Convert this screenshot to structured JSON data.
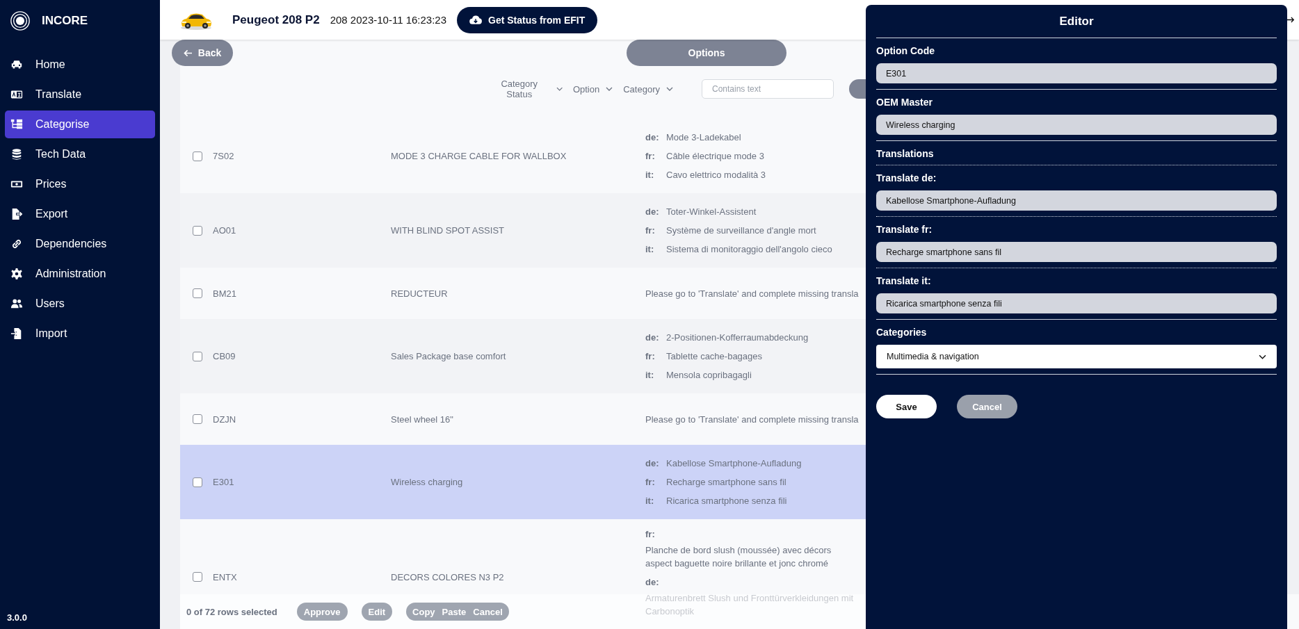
{
  "app": {
    "name": "INCORE",
    "version": "3.0.0"
  },
  "sidebar": {
    "items": [
      {
        "label": "Home",
        "selected": false
      },
      {
        "label": "Translate",
        "selected": false
      },
      {
        "label": "Categorise",
        "selected": true
      },
      {
        "label": "Tech Data",
        "selected": false
      },
      {
        "label": "Prices",
        "selected": false
      },
      {
        "label": "Export",
        "selected": false
      },
      {
        "label": "Dependencies",
        "selected": false
      },
      {
        "label": "Administration",
        "selected": false
      },
      {
        "label": "Users",
        "selected": false
      },
      {
        "label": "Import",
        "selected": false
      }
    ]
  },
  "header": {
    "vehicle": "Peugeot 208 P2",
    "snapshot": "208 2023-10-11 16:23:23",
    "status_button": "Get Status from EFIT"
  },
  "toolbar": {
    "back_button": "Back",
    "options_button": "Options"
  },
  "filters": [
    {
      "label": "Category Status"
    },
    {
      "label": "Option"
    },
    {
      "label": "Category"
    }
  ],
  "search": {
    "placeholder": "Contains text"
  },
  "table": {
    "rows": [
      {
        "kind": "inline",
        "checked": false,
        "selected": false,
        "code": "7S02",
        "description": "MODE 3 CHARGE CABLE FOR WALLBOX",
        "translations": [
          {
            "lang": "de:",
            "text": "Mode 3-Ladekabel"
          },
          {
            "lang": "fr:",
            "text": "Câble électrique mode 3"
          },
          {
            "lang": "it:",
            "text": "Cavo elettrico modalità 3"
          }
        ]
      },
      {
        "kind": "inline",
        "checked": false,
        "selected": false,
        "code": "AO01",
        "description": "WITH BLIND SPOT ASSIST",
        "translations": [
          {
            "lang": "de:",
            "text": "Toter-Winkel-Assistent"
          },
          {
            "lang": "fr:",
            "text": "Système de surveillance d'angle mort"
          },
          {
            "lang": "it:",
            "text": "Sistema di monitoraggio dell'angolo cieco"
          }
        ]
      },
      {
        "kind": "message",
        "checked": false,
        "selected": false,
        "code": "BM21",
        "description": "REDUCTEUR",
        "message": "Please go to 'Translate' and complete missing transla"
      },
      {
        "kind": "inline",
        "checked": false,
        "selected": false,
        "code": "CB09",
        "description": "Sales Package base comfort",
        "translations": [
          {
            "lang": "de:",
            "text": "2-Positionen-Kofferraumabdeckung"
          },
          {
            "lang": "fr:",
            "text": "Tablette cache-bagages"
          },
          {
            "lang": "it:",
            "text": "Mensola copribagagli"
          }
        ]
      },
      {
        "kind": "message",
        "checked": false,
        "selected": false,
        "code": "DZJN",
        "description": "Steel wheel 16\"",
        "message": "Please go to 'Translate' and complete missing transla"
      },
      {
        "kind": "inline",
        "checked": false,
        "selected": true,
        "code": "E301",
        "description": "Wireless charging",
        "translations": [
          {
            "lang": "de:",
            "text": "Kabellose Smartphone-Aufladung"
          },
          {
            "lang": "fr:",
            "text": "Recharge smartphone sans fil"
          },
          {
            "lang": "it:",
            "text": "Ricarica smartphone senza fili"
          }
        ]
      },
      {
        "kind": "stacked",
        "checked": false,
        "selected": false,
        "code": "ENTX",
        "description": "DECORS COLORES N3 P2",
        "translations": [
          {
            "lang": "fr:",
            "text": "Planche de bord slush (moussée) avec décors aspect baguette noire brillante et jonc chromé"
          },
          {
            "lang": "de:",
            "text": "Armaturenbrett Slush und Fronttürverkleidungen mit Carbonoptik"
          }
        ]
      }
    ]
  },
  "footer": {
    "selection": "0 of 72 rows selected",
    "buttons": [
      {
        "label": "Approve",
        "disabled": true
      },
      {
        "label": "Edit",
        "disabled": true
      }
    ],
    "clipboard_buttons": [
      {
        "label": "Copy",
        "disabled": true
      },
      {
        "label": "Paste",
        "disabled": true
      },
      {
        "label": "Cancel",
        "disabled": true
      }
    ]
  },
  "editor": {
    "title": "Editor",
    "fields": [
      {
        "kind": "input",
        "label": "Option Code",
        "value": "E301",
        "dotted_divider": false
      },
      {
        "kind": "input",
        "label": "OEM Master",
        "value": "Wireless charging",
        "dotted_divider": false
      },
      {
        "kind": "heading",
        "label": "Translations",
        "dotted_divider": true
      },
      {
        "kind": "input",
        "label": "Translate de:",
        "value": "Kabellose Smartphone-Aufladung",
        "dotted_divider": true
      },
      {
        "kind": "input",
        "label": "Translate fr:",
        "value": "Recharge smartphone sans fil",
        "dotted_divider": true
      },
      {
        "kind": "input",
        "label": "Translate it:",
        "value": "Ricarica smartphone senza fili",
        "dotted_divider": false
      },
      {
        "kind": "select",
        "label": "Categories",
        "value": "Multimedia & navigation",
        "dotted_divider": false
      }
    ],
    "buttons": [
      {
        "label": "Save",
        "kind": "primary"
      },
      {
        "label": "Cancel",
        "kind": "secondary"
      }
    ]
  }
}
